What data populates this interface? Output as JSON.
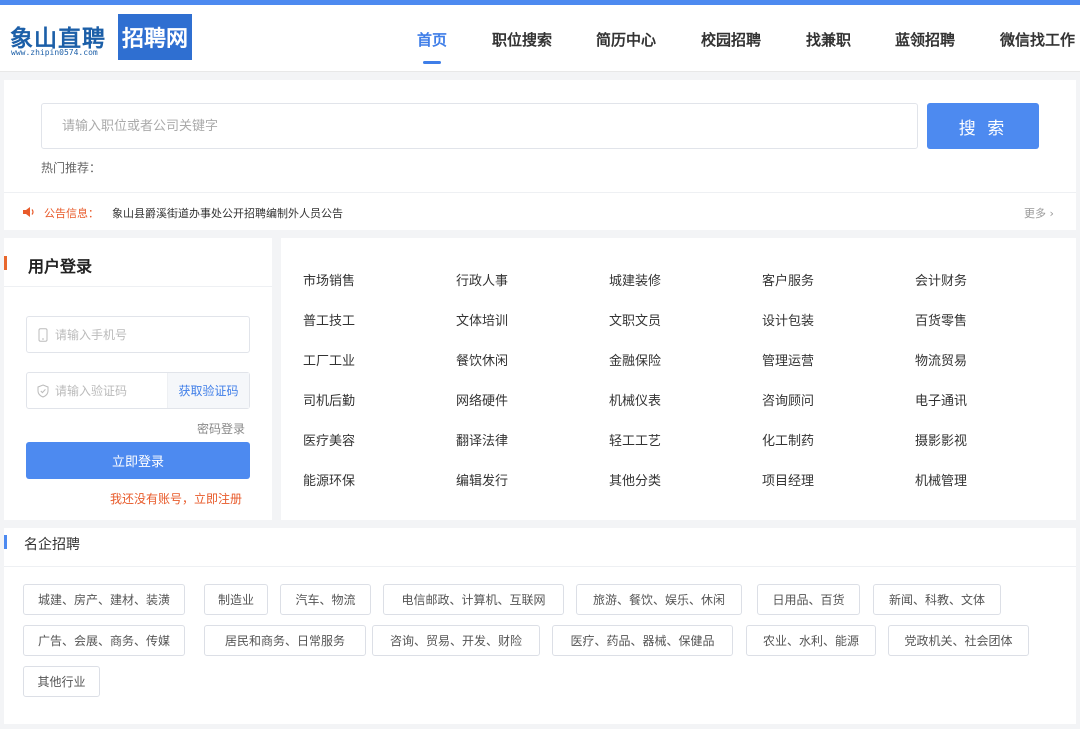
{
  "header": {
    "logo_text": "象山直聘",
    "logo_url": "www.zhipin0574.com",
    "logo_box": "招聘网",
    "nav": [
      {
        "label": "首页",
        "active": true
      },
      {
        "label": "职位搜索"
      },
      {
        "label": "简历中心"
      },
      {
        "label": "校园招聘"
      },
      {
        "label": "找兼职"
      },
      {
        "label": "蓝领招聘"
      },
      {
        "label": "微信找工作"
      }
    ]
  },
  "search": {
    "placeholder": "请输入职位或者公司关键字",
    "button": "搜 索",
    "hot_label": "热门推荐："
  },
  "notice": {
    "label": "公告信息：",
    "text": "象山县爵溪街道办事处公开招聘编制外人员公告",
    "more": "更多 ›"
  },
  "login": {
    "title": "用户登录",
    "phone_placeholder": "请输入手机号",
    "code_placeholder": "请输入验证码",
    "get_code": "获取验证码",
    "password_login": "密码登录",
    "submit": "立即登录",
    "register": "我还没有账号，立即注册"
  },
  "categories": [
    [
      "市场销售",
      "行政人事",
      "城建装修",
      "客户服务",
      "会计财务"
    ],
    [
      "普工技工",
      "文体培训",
      "文职文员",
      "设计包装",
      "百货零售"
    ],
    [
      "工厂工业",
      "餐饮休闲",
      "金融保险",
      "管理运营",
      "物流贸易"
    ],
    [
      "司机后勤",
      "网络硬件",
      "机械仪表",
      "咨询顾问",
      "电子通讯"
    ],
    [
      "医疗美容",
      "翻译法律",
      "轻工工艺",
      "化工制药",
      "摄影影视"
    ],
    [
      "能源环保",
      "编辑发行",
      "其他分类",
      "项目经理",
      "机械管理"
    ]
  ],
  "companies": {
    "title": "名企招聘",
    "tags": [
      [
        "城建、房产、建材、装潢",
        "制造业",
        "汽车、物流",
        "电信邮政、计算机、互联网",
        "旅游、餐饮、娱乐、休闲",
        "日用品、百货",
        "新闻、科教、文体"
      ],
      [
        "广告、会展、商务、传媒",
        "居民和商务、日常服务",
        "咨询、贸易、开发、财险",
        "医疗、药品、器械、保健品",
        "农业、水利、能源",
        "党政机关、社会团体"
      ],
      [
        "其他行业"
      ]
    ]
  },
  "colors": {
    "accent": "#4d8af0",
    "notice": "#e85a2a"
  }
}
